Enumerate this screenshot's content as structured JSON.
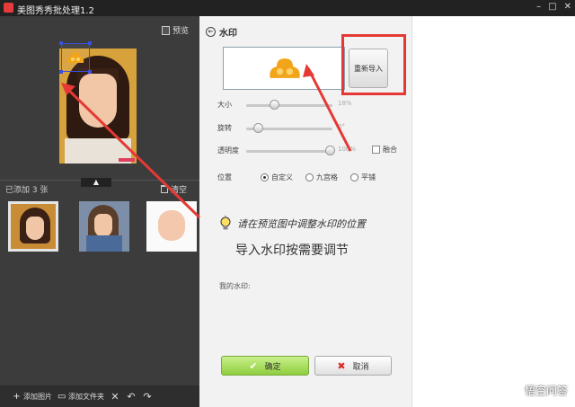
{
  "window": {
    "title": "美图秀秀批处理1.2",
    "controls": [
      "–",
      "□",
      "✕"
    ]
  },
  "left_panel": {
    "preview_label": "预览",
    "added_label": "已添加 3 张",
    "clear_label": "清空",
    "thumbnails": [
      "photo-1",
      "photo-2",
      "photo-3"
    ],
    "bottom": {
      "add_image": "添加图片",
      "add_folder": "添加文件夹"
    }
  },
  "watermark_panel": {
    "title": "水印",
    "reimport": "重新导入",
    "sliders": [
      {
        "label": "大小",
        "value": "18%",
        "level": 0.18
      },
      {
        "label": "旋转",
        "value": "0°",
        "level": 0.0
      },
      {
        "label": "透明度",
        "value": "100%",
        "level": 1.0
      }
    ],
    "blend_label": "融合",
    "position_label": "位置",
    "position_options": [
      {
        "label": "自定义",
        "selected": true
      },
      {
        "label": "九宫格",
        "selected": false
      },
      {
        "label": "平铺",
        "selected": false
      }
    ],
    "hint_handwritten": "请在预览图中调整水印的位置",
    "hint_main": "导入水印按需要调节",
    "my_watermark": "我的水印:",
    "ok_label": "确定",
    "cancel_label": "取消"
  },
  "footer_watermark": "悟空问答",
  "colors": {
    "annotation_red": "#e53935",
    "selection_blue": "#3a4fdc",
    "ok_green": "#8fce3e"
  }
}
